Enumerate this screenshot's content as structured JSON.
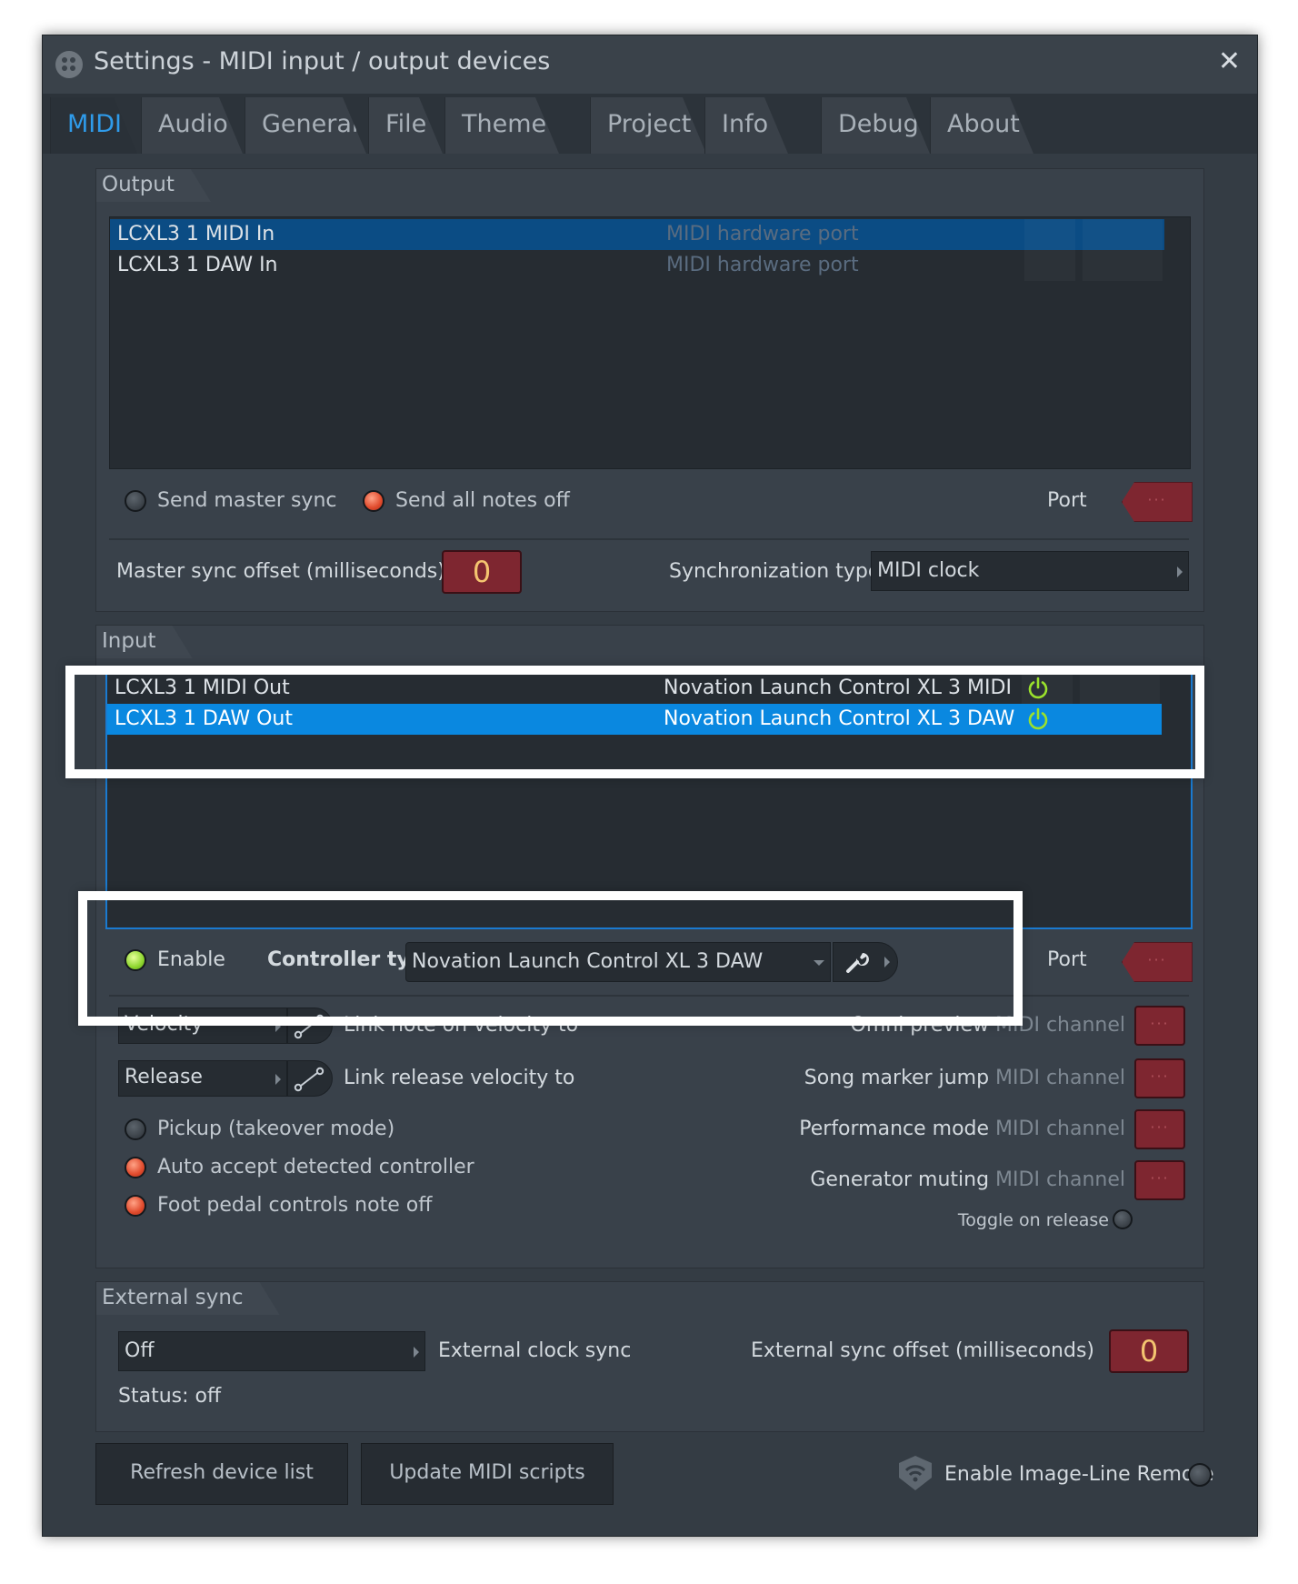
{
  "window": {
    "title": "Settings - MIDI input / output devices",
    "close_glyph": "✕"
  },
  "tabs": [
    {
      "label": "MIDI",
      "active": true
    },
    {
      "label": "Audio"
    },
    {
      "label": "General"
    },
    {
      "label": "File"
    },
    {
      "label": "Theme"
    },
    {
      "label": "Project"
    },
    {
      "label": "Info"
    },
    {
      "label": "Debug"
    },
    {
      "label": "About"
    }
  ],
  "output": {
    "label": "Output",
    "devices": [
      {
        "name": "LCXL3 1 MIDI In",
        "type": "MIDI hardware port",
        "selected": true
      },
      {
        "name": "LCXL3 1 DAW In",
        "type": "MIDI hardware port",
        "selected": false
      }
    ],
    "send_master_sync": "Send master sync",
    "send_all_notes_off": "Send all notes off",
    "port_label": "Port",
    "port_value": "···",
    "master_sync_offset_label": "Master sync offset (milliseconds)",
    "master_sync_offset_value": "0",
    "sync_type_label": "Synchronization type",
    "sync_type_value": "MIDI clock"
  },
  "input": {
    "label": "Input",
    "devices": [
      {
        "name": "LCXL3 1 MIDI Out",
        "controller": "Novation Launch Control XL 3 MIDI",
        "selected": false
      },
      {
        "name": "LCXL3 1 DAW Out",
        "controller": "Novation Launch Control XL 3 DAW",
        "selected": true
      }
    ],
    "enable_label": "Enable",
    "controller_type_label": "Controller type",
    "controller_type_value": "Novation Launch Control XL 3 DAW",
    "port_label": "Port",
    "port_value": "···",
    "velocity_combo": "Velocity",
    "link_velocity_label": "Link note on velocity to",
    "release_combo": "Release",
    "link_release_label": "Link release velocity to",
    "pickup_label": "Pickup (takeover mode)",
    "auto_accept_label": "Auto accept detected controller",
    "foot_pedal_label": "Foot pedal controls note off",
    "omni_preview_label": "Omni preview",
    "song_marker_label": "Song marker jump",
    "performance_mode_label": "Performance mode",
    "generator_muting_label": "Generator muting",
    "midi_channel_suffix": "MIDI channel",
    "channel_value": "···",
    "toggle_on_release_label": "Toggle on release"
  },
  "external_sync": {
    "label": "External sync",
    "clock_value": "Off",
    "clock_label": "External clock sync",
    "offset_label": "External sync offset (milliseconds)",
    "offset_value": "0",
    "status": "Status: off"
  },
  "footer": {
    "refresh_label": "Refresh device list",
    "update_label": "Update MIDI scripts",
    "remote_label": "Enable Image-Line Remote"
  },
  "colors": {
    "accent_blue": "#2f9bea",
    "selection_blue": "#0a88e0",
    "dim_selection": "#0b4c84",
    "power_green": "#9ae12c",
    "red_control": "#7e2630",
    "highlight_box": "#ffffff"
  }
}
